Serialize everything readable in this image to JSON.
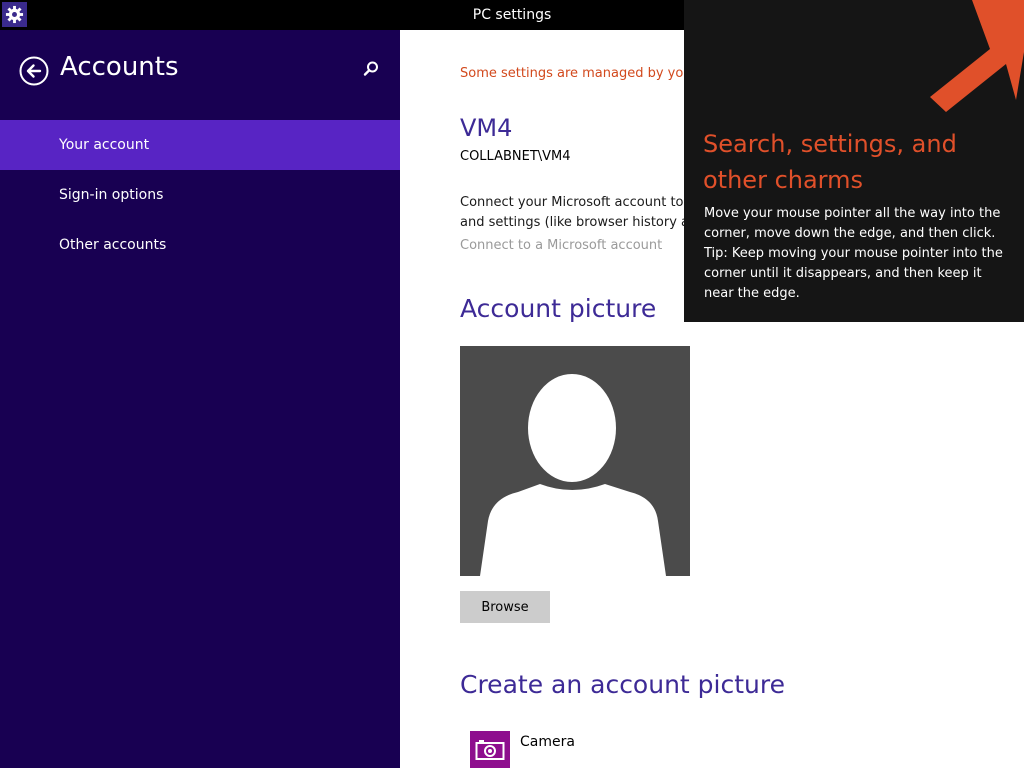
{
  "window": {
    "title": "PC settings",
    "app_icon": "gear-icon"
  },
  "sidebar": {
    "heading": "Accounts",
    "back_icon": "back-arrow-circle-icon",
    "search_icon": "search-icon",
    "items": [
      {
        "label": "Your account",
        "selected": true
      },
      {
        "label": "Sign-in options",
        "selected": false
      },
      {
        "label": "Other accounts",
        "selected": false
      }
    ]
  },
  "main": {
    "managed_note": "Some settings are managed by yo",
    "account_name": "VM4",
    "account_domain": "COLLABNET\\VM4",
    "connect_line1": "Connect your Microsoft account to",
    "connect_line2": "and settings (like browser history ar",
    "connect_link": "Connect to a Microsoft account",
    "account_picture_heading": "Account picture",
    "browse_label": "Browse",
    "create_heading": "Create an account picture",
    "camera_label": "Camera",
    "camera_icon": "camera-icon"
  },
  "charms_tip": {
    "title": "Search, settings, and other charms",
    "body": "Move your mouse pointer all the way into the corner, move down the edge, and then click. Tip: Keep moving your mouse pointer into the corner until it disappears, and then keep it near the edge.",
    "arrow_icon": "arrow-up-right-icon"
  },
  "colors": {
    "sidebar_bg": "#180052",
    "selected_bg": "#5824c4",
    "accent_text": "#3d2a96",
    "warning_text": "#d2491d",
    "tip_title": "#e0502a",
    "camera_tile": "#8e0e8e"
  }
}
